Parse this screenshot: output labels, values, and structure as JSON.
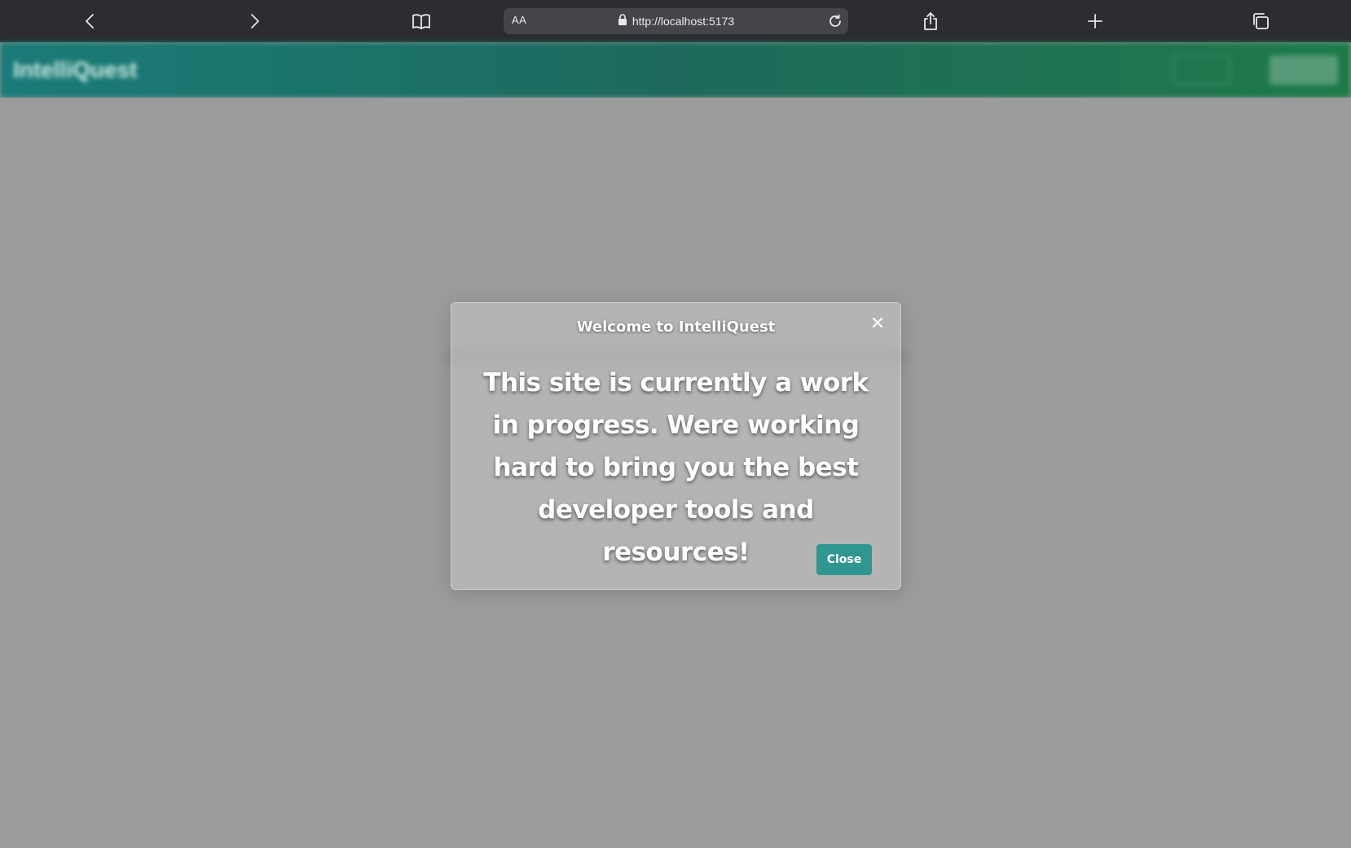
{
  "browser": {
    "reader_label": "AA",
    "url": "http://localhost:5173",
    "icons": [
      "back-icon",
      "forward-icon",
      "bookmarks-icon",
      "lock-icon",
      "reload-icon",
      "share-icon",
      "new-tab-icon",
      "tabs-icon"
    ]
  },
  "app": {
    "logo": "IntelliQuest",
    "brand_colors": [
      "#1a7b78",
      "#1f7a4a"
    ]
  },
  "modal": {
    "title": "Welcome to IntelliQuest",
    "message": "This site is currently a work in progress. Were working hard to bring you the best developer tools and resources!",
    "close_button_label": "Close",
    "close_button_color": "#2f9690"
  }
}
